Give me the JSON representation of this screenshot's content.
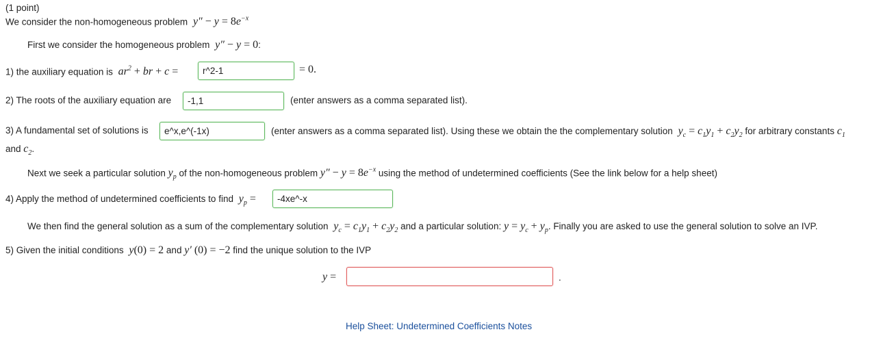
{
  "header": {
    "points": "(1 point)"
  },
  "intro": {
    "text": "We consider the non-homogeneous problem",
    "homog_text": "First we consider the homogeneous problem"
  },
  "q1": {
    "label": "1) the auxiliary equation is",
    "value": "r^2-1",
    "after": "= 0."
  },
  "q2": {
    "label": "2) The roots of the auxiliary equation are",
    "value": "-1,1",
    "after": "(enter answers as a comma separated list)."
  },
  "q3": {
    "label": "3) A fundamental set of solutions is",
    "value": "e^x,e^(-1x)",
    "after": "(enter answers as a comma separated list). Using these we obtain the the complementary solution",
    "after2": "for arbitrary constants",
    "and": "and"
  },
  "next": {
    "text": "Next we seek a particular solution",
    "text2": "of the non-homogeneous problem",
    "text3": "using the method of undetermined coefficients (See the link below for a help sheet)"
  },
  "q4": {
    "label": "4) Apply the method of undetermined coefficients to find",
    "value": "-4xe^-x"
  },
  "general": {
    "text": "We then find the general solution as a sum of the complementary solution",
    "text2": "and a particular solution:",
    "text3": ". Finally you are asked to use the general solution to solve an IVP."
  },
  "q5": {
    "label": "5) Given the initial conditions",
    "and": "and",
    "after": "find the unique solution to the IVP",
    "value": ""
  },
  "help_link": "Help Sheet: Undetermined Coefficients Notes",
  "colors": {
    "correct": "#5cb85c",
    "incorrect": "#e05a5a",
    "link": "#1a4f9c"
  }
}
